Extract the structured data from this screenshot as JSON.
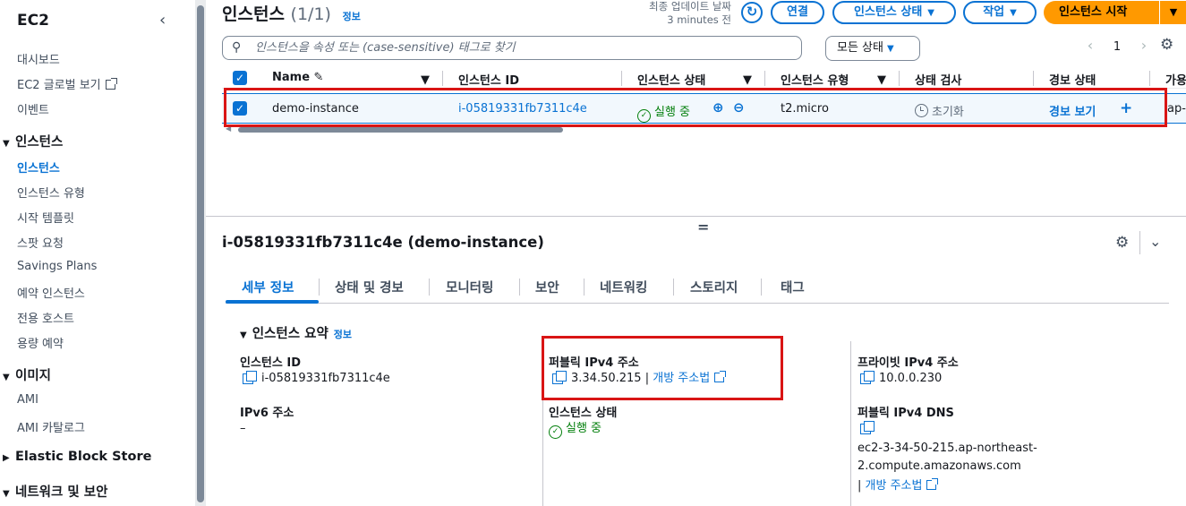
{
  "sidebar": {
    "title": "EC2",
    "close_icon": "chevron-left-icon",
    "links": {
      "dashboard": "대시보드",
      "global_view": "EC2 글로벌 보기",
      "events": "이벤트"
    },
    "instances_section": {
      "label": "인스턴스",
      "items": [
        "인스턴스",
        "인스턴스 유형",
        "시작 템플릿",
        "스팟 요청",
        "Savings Plans",
        "예약 인스턴스",
        "전용 호스트",
        "용량 예약"
      ]
    },
    "images_section": {
      "label": "이미지",
      "items": [
        "AMI",
        "AMI 카탈로그"
      ]
    },
    "ebs_section": {
      "label": "Elastic Block Store"
    },
    "network_section": {
      "label": "네트워크 및 보안"
    }
  },
  "header": {
    "title": "인스턴스",
    "count": "(1/1)",
    "info": "정보",
    "last_updated_label": "최종 업데이트 날짜",
    "last_updated_value": "3 minutes 전",
    "connect": "연결",
    "instance_state": "인스턴스 상태",
    "actions": "작업",
    "launch": "인스턴스 시작"
  },
  "search": {
    "placeholder": "인스턴스을 속성 또는 (case-sensitive) 태그로 찾기"
  },
  "state_filter": "모든 상태",
  "pager": {
    "page": "1"
  },
  "table": {
    "columns": [
      "Name",
      "인스턴스 ID",
      "인스턴스 상태",
      "인스턴스 유형",
      "상태 검사",
      "경보 상태",
      "가용"
    ],
    "row": {
      "name": "demo-instance",
      "instance_id": "i-05819331fb7311c4e",
      "state": "실행 중",
      "type": "t2.micro",
      "status_check": "초기화",
      "alarm_view": "경보 보기",
      "az": "ap-"
    }
  },
  "details": {
    "title": "i-05819331fb7311c4e (demo-instance)",
    "tabs": [
      "세부 정보",
      "상태 및 경보",
      "모니터링",
      "보안",
      "네트워킹",
      "스토리지",
      "태그"
    ],
    "summary_title": "인스턴스 요약",
    "summary_info": "정보",
    "instance_id_label": "인스턴스 ID",
    "instance_id": "i-05819331fb7311c4e",
    "ipv6_label": "IPv6 주소",
    "ipv6_value": "–",
    "public_ipv4_label": "퍼블릭 IPv4 주소",
    "public_ipv4": "3.34.50.215",
    "open_address": "개방 주소법",
    "state_label": "인스턴스 상태",
    "state_value": "실행 중",
    "private_ipv4_label": "프라이빗 IPv4 주소",
    "private_ipv4": "10.0.0.230",
    "public_dns_label": "퍼블릭 IPv4 DNS",
    "public_dns_line1": "ec2-3-34-50-215.ap-northeast-",
    "public_dns_line2": "2.compute.amazonaws.com",
    "dns_open_address": "개방 주소법"
  },
  "colors": {
    "accent": "#0972d3",
    "primary_button": "#ff9900",
    "success": "#037f0c",
    "highlight": "#d91515"
  }
}
